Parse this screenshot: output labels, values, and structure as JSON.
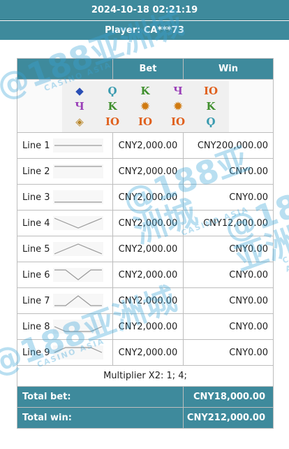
{
  "header": {
    "datetime": "2024-10-18 02:21:19",
    "player": "Player: CA***73"
  },
  "table": {
    "col_bet": "Bet",
    "col_win": "Win"
  },
  "reels": [
    [
      "blue-gem",
      "teal-Q",
      "green-K",
      "purple-J",
      "orange-10"
    ],
    [
      "purple-J",
      "green-K",
      "orange-medallion",
      "orange-medallion",
      "green-K"
    ],
    [
      "gold-gem",
      "orange-10",
      "orange-10",
      "orange-10",
      "teal-Q"
    ]
  ],
  "lines": [
    {
      "name": "Line 1",
      "bet": "CNY2,000.00",
      "win": "CNY200,000.00"
    },
    {
      "name": "Line 2",
      "bet": "CNY2,000.00",
      "win": "CNY0.00"
    },
    {
      "name": "Line 3",
      "bet": "CNY2,000.00",
      "win": "CNY0.00"
    },
    {
      "name": "Line 4",
      "bet": "CNY2,000.00",
      "win": "CNY12,000.00"
    },
    {
      "name": "Line 5",
      "bet": "CNY2,000.00",
      "win": "CNY0.00"
    },
    {
      "name": "Line 6",
      "bet": "CNY2,000.00",
      "win": "CNY0.00"
    },
    {
      "name": "Line 7",
      "bet": "CNY2,000.00",
      "win": "CNY0.00"
    },
    {
      "name": "Line 8",
      "bet": "CNY2,000.00",
      "win": "CNY0.00"
    },
    {
      "name": "Line 9",
      "bet": "CNY2,000.00",
      "win": "CNY0.00"
    }
  ],
  "multiplier": "Multiplier X2: 1; 4;",
  "totals": {
    "bet_label": "Total bet:",
    "bet_value": "CNY18,000.00",
    "win_label": "Total win:",
    "win_value": "CNY212,000.00"
  },
  "colors": {
    "header_bg": "#3e8a9c",
    "watermark": "#39a4d8"
  },
  "watermark": {
    "main": "@188亚洲城",
    "sub": "CASINO ASIA"
  }
}
